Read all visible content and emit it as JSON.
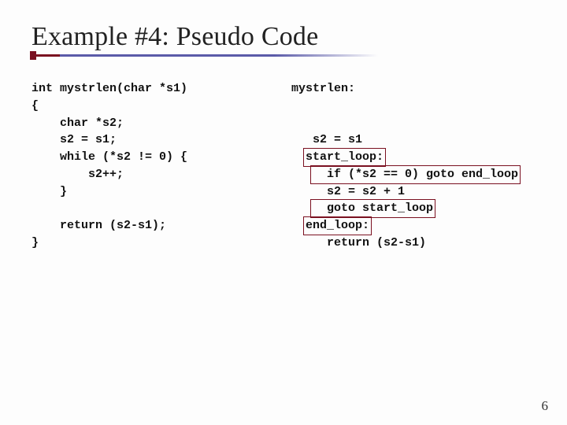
{
  "title": "Example #4: Pseudo Code",
  "page_number": "6",
  "left": {
    "l0": "int mystrlen(char *s1)",
    "l1": "{",
    "l2": "    char *s2;",
    "l3": "    s2 = s1;",
    "l4": "    while (*s2 != 0) {",
    "l5": "        s2++;",
    "l6": "    }",
    "l7": "",
    "l8": "    return (s2-s1);",
    "l9": "}"
  },
  "right": {
    "r0": "mystrlen:",
    "r1": "",
    "r2": "",
    "r3": "   s2 = s1",
    "r4_pre": "  ",
    "r4_hl": "start_loop:",
    "r5_pre": "   ",
    "r5_hl": "  if (*s2 == 0) goto end_loop",
    "r6": "     s2 = s2 + 1",
    "r7_pre": "   ",
    "r7_hl": "  goto start_loop",
    "r8_pre": "  ",
    "r8_hl": "end_loop:",
    "r9": "     return (s2-s1)"
  }
}
